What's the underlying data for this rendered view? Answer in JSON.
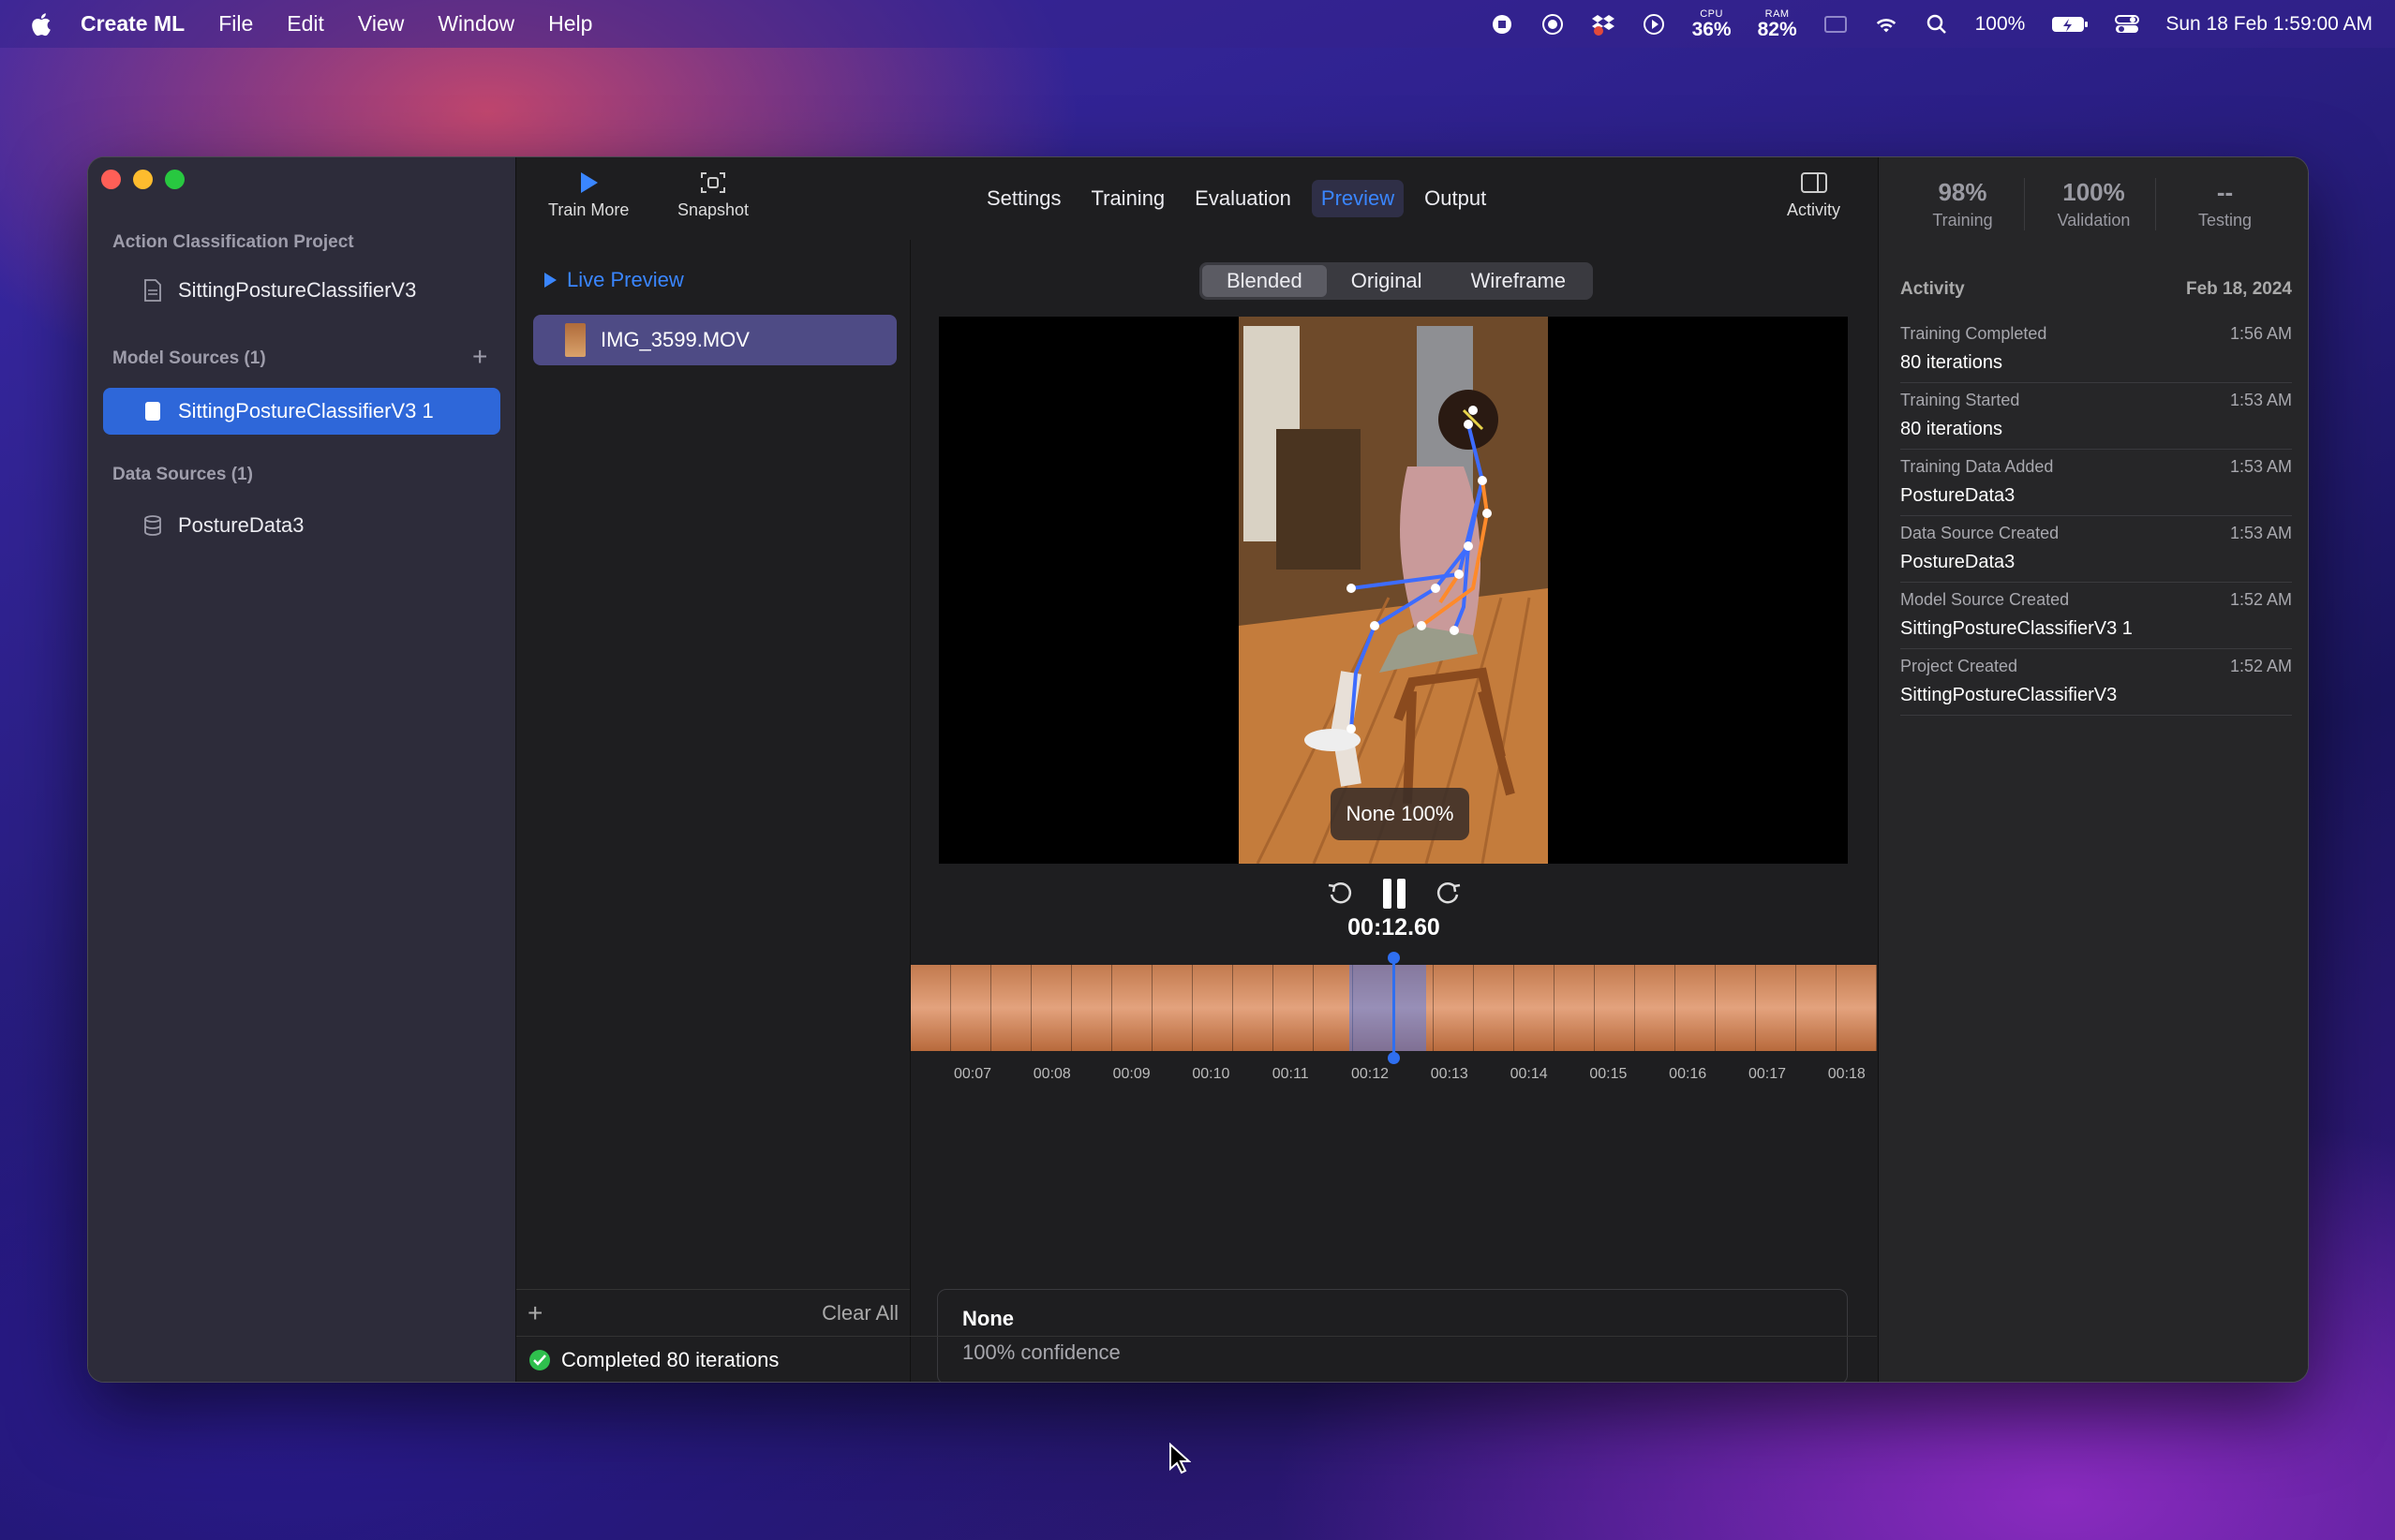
{
  "menubar": {
    "app": "Create ML",
    "items": [
      "File",
      "Edit",
      "View",
      "Window",
      "Help"
    ],
    "cpu_label": "CPU",
    "cpu_value": "36%",
    "ram_label": "RAM",
    "ram_value": "82%",
    "battery": "100%",
    "datetime": "Sun 18 Feb  1:59:00 AM"
  },
  "sidebar": {
    "project_header": "Action Classification Project",
    "project_item": "SittingPostureClassifierV3",
    "model_sources_header": "Model Sources (1)",
    "model_item": "SittingPostureClassifierV3 1",
    "data_sources_header": "Data Sources (1)",
    "data_item": "PostureData3"
  },
  "toolbar": {
    "train_more": "Train More",
    "snapshot": "Snapshot",
    "tabs": [
      "Settings",
      "Training",
      "Evaluation",
      "Preview",
      "Output"
    ],
    "active_tab": "Preview",
    "activity": "Activity"
  },
  "filepane": {
    "live_preview": "Live Preview",
    "file": "IMG_3599.MOV",
    "add": "+",
    "clear_all": "Clear All"
  },
  "preview": {
    "modes": [
      "Blended",
      "Original",
      "Wireframe"
    ],
    "active_mode": "Blended",
    "overlay_label": "None 100%",
    "time": "00:12.60",
    "timeline_ticks": [
      "00:07",
      "00:08",
      "00:09",
      "00:10",
      "00:11",
      "00:12",
      "00:13",
      "00:14",
      "00:15",
      "00:16",
      "00:17",
      "00:18"
    ],
    "result_title": "None",
    "result_confidence": "100% confidence"
  },
  "status": {
    "text": "Completed 80 iterations"
  },
  "metrics": [
    {
      "value": "98%",
      "label": "Training"
    },
    {
      "value": "100%",
      "label": "Validation"
    },
    {
      "value": "--",
      "label": "Testing"
    }
  ],
  "activity": {
    "header": "Activity",
    "date": "Feb 18, 2024",
    "events": [
      {
        "title": "Training Completed",
        "time": "1:56 AM",
        "detail": "80 iterations"
      },
      {
        "title": "Training Started",
        "time": "1:53 AM",
        "detail": "80 iterations"
      },
      {
        "title": "Training Data Added",
        "time": "1:53 AM",
        "detail": "PostureData3"
      },
      {
        "title": "Data Source Created",
        "time": "1:53 AM",
        "detail": "PostureData3"
      },
      {
        "title": "Model Source Created",
        "time": "1:52 AM",
        "detail": "SittingPostureClassifierV3 1"
      },
      {
        "title": "Project Created",
        "time": "1:52 AM",
        "detail": "SittingPostureClassifierV3"
      }
    ]
  },
  "colors": {
    "accent": "#3a86ff",
    "selection": "#2e67d9",
    "file_selection": "#4e4b85",
    "success": "#2fbf4d"
  }
}
